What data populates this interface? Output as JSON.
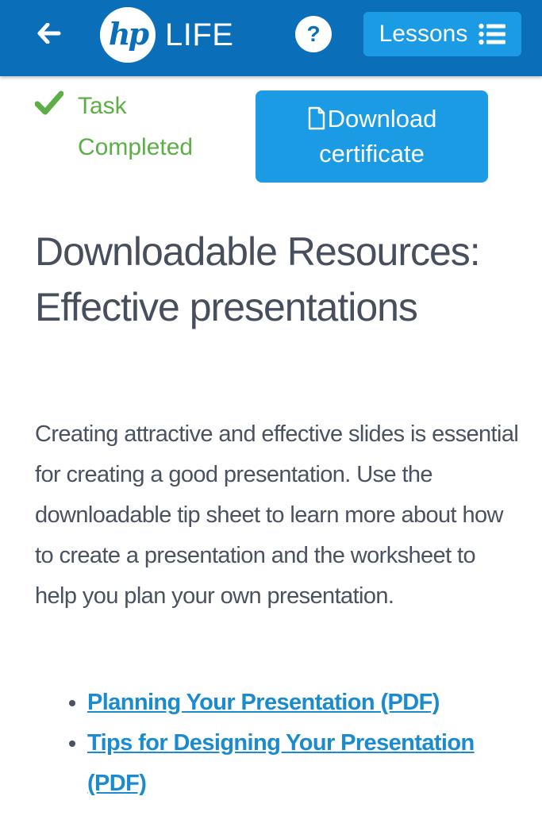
{
  "header": {
    "logo_mark": "hp",
    "logo_text": "LIFE",
    "help_label": "?",
    "lessons_label": "Lessons",
    "colors": {
      "bar": "#0a6fb8",
      "button": "#1a9be3"
    },
    "icons": [
      "back-arrow-icon",
      "help-icon",
      "list-icon"
    ]
  },
  "status": {
    "label_line1": "Task",
    "label_line2": "Completed",
    "icon": "checkmark-icon",
    "color": "#5cae47"
  },
  "certificate_button": {
    "line1": "Download",
    "line2": "certificate",
    "icon": "document-icon"
  },
  "content": {
    "title": "Downloadable Resources: Effective presentations",
    "description": "Creating attractive and effective slides is essential for creating a good presentation. Use the downloadable tip sheet to learn more about how to create a presentation and the worksheet to help you plan your own presentation.",
    "links": [
      {
        "label": "Planning Your Presentation (PDF)"
      },
      {
        "label": "Tips for Designing Your Presentation (PDF)"
      }
    ],
    "link_color": "#1a8bcf"
  }
}
